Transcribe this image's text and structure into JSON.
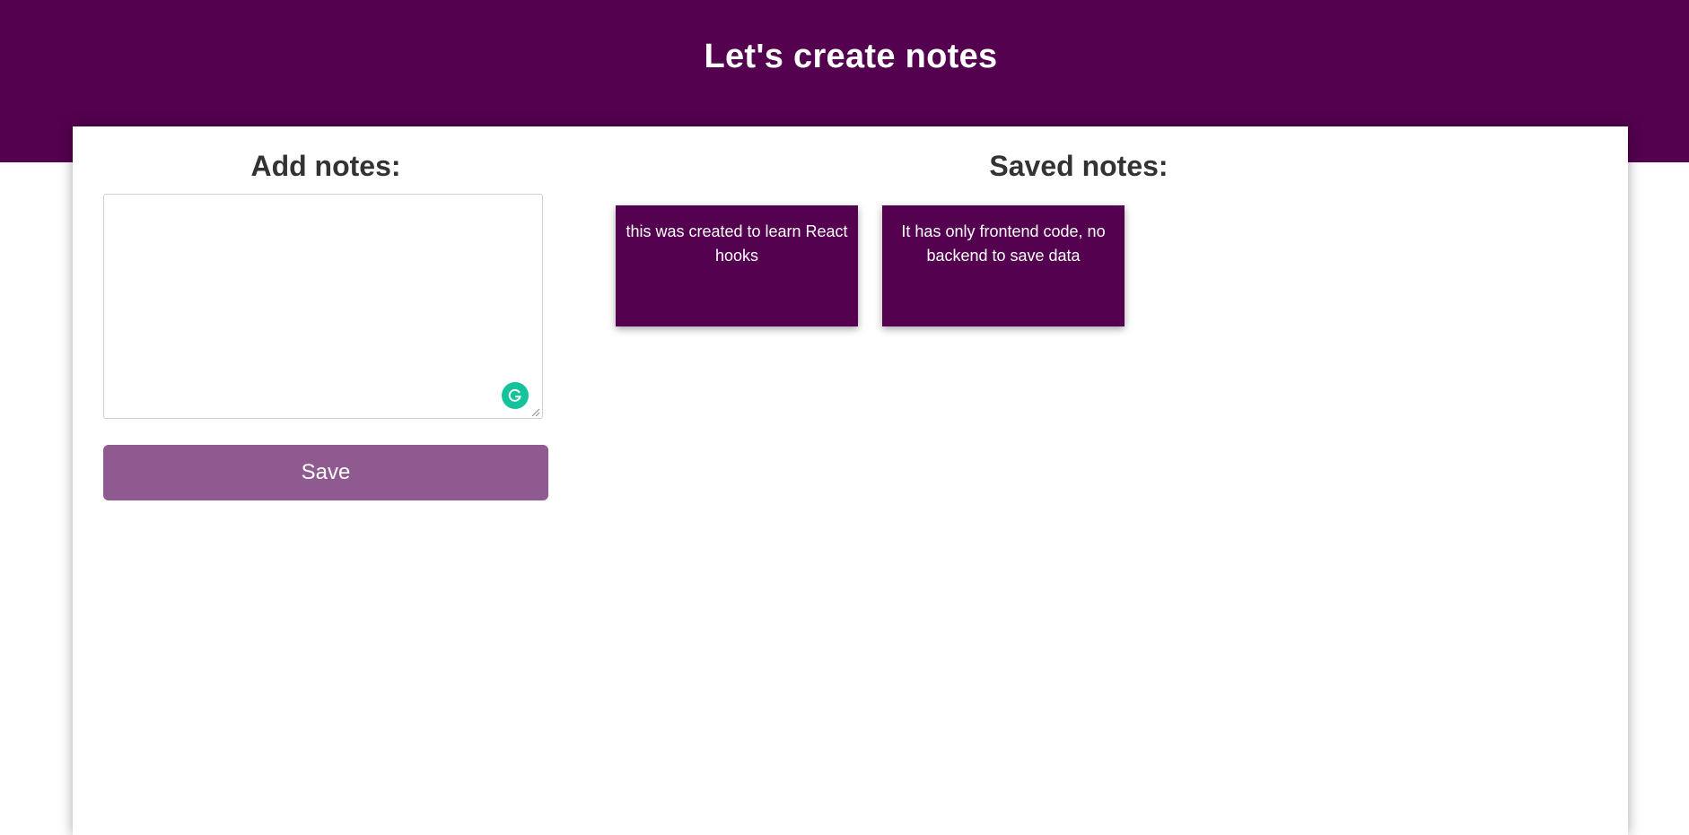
{
  "header": {
    "title": "Let's create notes"
  },
  "add_section": {
    "heading": "Add notes:",
    "input_value": "",
    "save_label": "Save"
  },
  "saved_section": {
    "heading": "Saved notes:",
    "notes": [
      "this was created to learn React hooks",
      "It has only frontend code, no backend to save data"
    ]
  },
  "colors": {
    "brand": "#54014f",
    "button": "#8f5a8f",
    "grammarly": "#15c39a"
  },
  "icons": {
    "grammarly": "grammarly-icon",
    "resize": "resize-handle-icon"
  }
}
